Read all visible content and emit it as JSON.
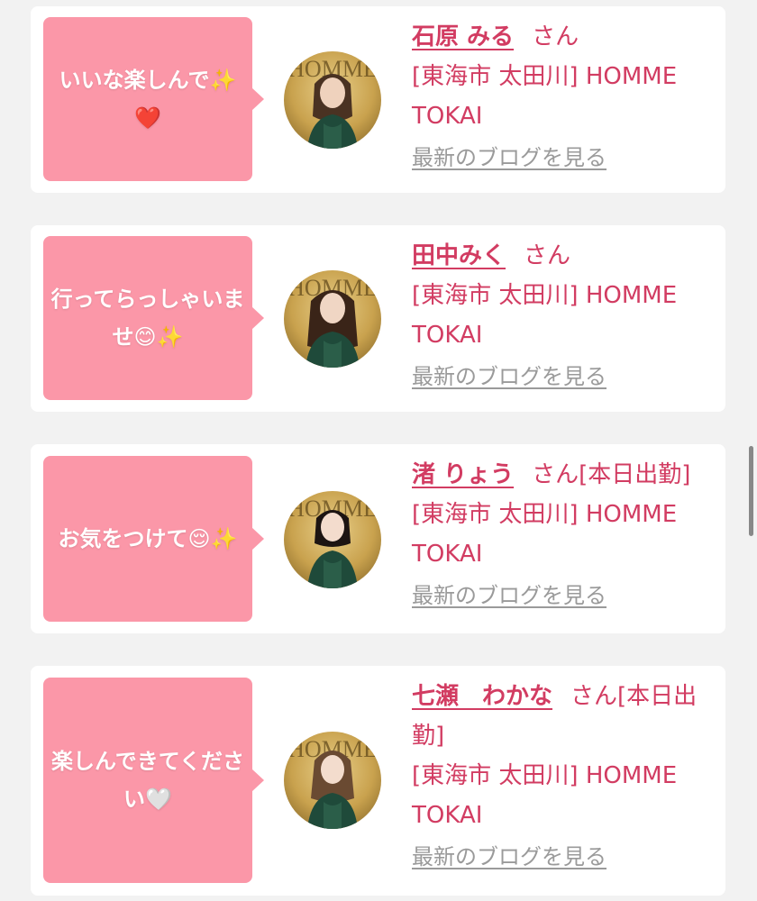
{
  "cards": [
    {
      "message": "いいな楽しんで✨❤️",
      "name": "石原 みる",
      "honorific": "さん",
      "status": "",
      "shop": "[東海市 太田川] HOMME TOKAI",
      "blog_link": "最新のブログを見る"
    },
    {
      "message": "行ってらっしゃいませ😊✨",
      "name": "田中みく",
      "honorific": "さん",
      "status": "",
      "shop": "[東海市 太田川] HOMME TOKAI",
      "blog_link": "最新のブログを見る"
    },
    {
      "message": "お気をつけて😌✨",
      "name": "渚 りょう",
      "honorific": "さん",
      "status": "[本日出勤]",
      "shop": "[東海市 太田川] HOMME TOKAI",
      "blog_link": "最新のブログを見る"
    },
    {
      "message": "楽しんできてください🤍",
      "name": "七瀬　わかな",
      "honorific": "さん",
      "status": "[本日出勤]",
      "shop": "[東海市 太田川] HOMME TOKAI",
      "blog_link": "最新のブログを見る"
    }
  ],
  "colors": {
    "page_background": "#f2f2f2",
    "card_background": "#ffffff",
    "bubble": "#fb97a8",
    "accent_text": "#d23c62",
    "link_gray": "#9a9a9a"
  }
}
